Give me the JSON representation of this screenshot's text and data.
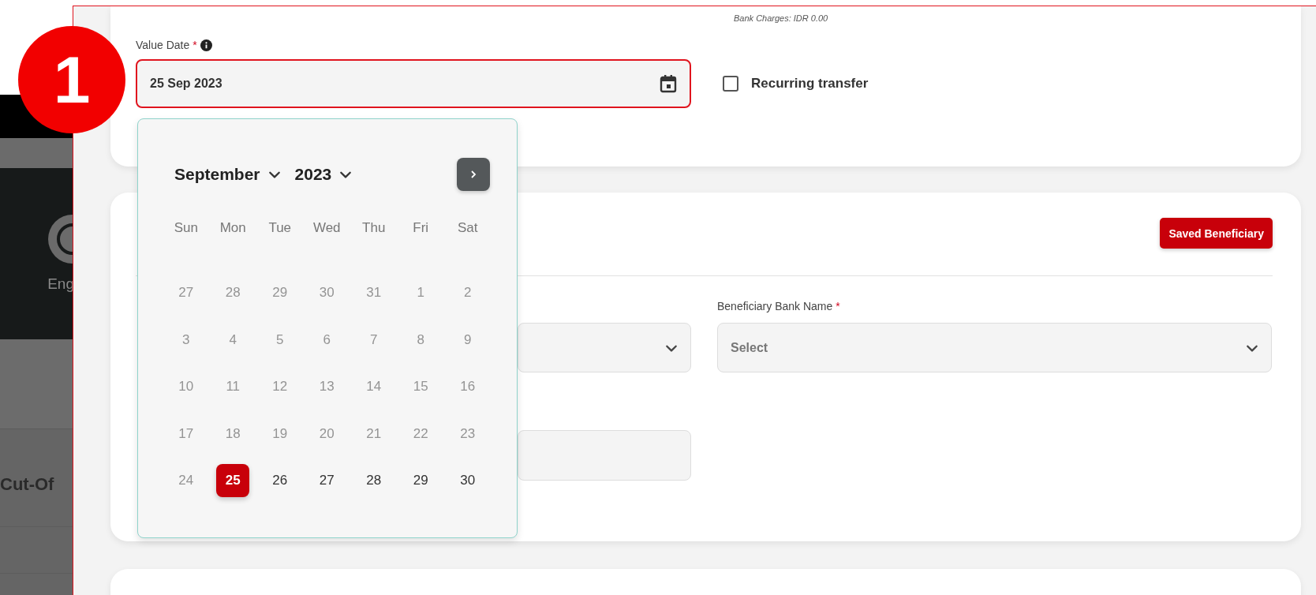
{
  "step_badge": "1",
  "background_panel": {
    "language_label": "Eng",
    "cutoff_label": "Cut-Of"
  },
  "bank_charges": "Bank Charges: IDR 0.00",
  "value_date": {
    "label": "Value Date",
    "required_mark": "*",
    "value": "25 Sep 2023",
    "focused": true
  },
  "recurring_transfer": {
    "label": "Recurring transfer",
    "checked": false
  },
  "calendar": {
    "month": "September",
    "year": "2023",
    "weekdays": [
      "Sun",
      "Mon",
      "Tue",
      "Wed",
      "Thu",
      "Fri",
      "Sat"
    ],
    "days": [
      {
        "label": "27",
        "disabled": true,
        "selected": false
      },
      {
        "label": "28",
        "disabled": true,
        "selected": false
      },
      {
        "label": "29",
        "disabled": true,
        "selected": false
      },
      {
        "label": "30",
        "disabled": true,
        "selected": false
      },
      {
        "label": "31",
        "disabled": true,
        "selected": false
      },
      {
        "label": "1",
        "disabled": true,
        "selected": false
      },
      {
        "label": "2",
        "disabled": true,
        "selected": false
      },
      {
        "label": "3",
        "disabled": true,
        "selected": false
      },
      {
        "label": "4",
        "disabled": true,
        "selected": false
      },
      {
        "label": "5",
        "disabled": true,
        "selected": false
      },
      {
        "label": "6",
        "disabled": true,
        "selected": false
      },
      {
        "label": "7",
        "disabled": true,
        "selected": false
      },
      {
        "label": "8",
        "disabled": true,
        "selected": false
      },
      {
        "label": "9",
        "disabled": true,
        "selected": false
      },
      {
        "label": "10",
        "disabled": true,
        "selected": false
      },
      {
        "label": "11",
        "disabled": true,
        "selected": false
      },
      {
        "label": "12",
        "disabled": true,
        "selected": false
      },
      {
        "label": "13",
        "disabled": true,
        "selected": false
      },
      {
        "label": "14",
        "disabled": true,
        "selected": false
      },
      {
        "label": "15",
        "disabled": true,
        "selected": false
      },
      {
        "label": "16",
        "disabled": true,
        "selected": false
      },
      {
        "label": "17",
        "disabled": true,
        "selected": false
      },
      {
        "label": "18",
        "disabled": true,
        "selected": false
      },
      {
        "label": "19",
        "disabled": true,
        "selected": false
      },
      {
        "label": "20",
        "disabled": true,
        "selected": false
      },
      {
        "label": "21",
        "disabled": true,
        "selected": false
      },
      {
        "label": "22",
        "disabled": true,
        "selected": false
      },
      {
        "label": "23",
        "disabled": true,
        "selected": false
      },
      {
        "label": "24",
        "disabled": true,
        "selected": false
      },
      {
        "label": "25",
        "disabled": false,
        "selected": true
      },
      {
        "label": "26",
        "disabled": false,
        "selected": false
      },
      {
        "label": "27",
        "disabled": false,
        "selected": false
      },
      {
        "label": "28",
        "disabled": false,
        "selected": false
      },
      {
        "label": "29",
        "disabled": false,
        "selected": false
      },
      {
        "label": "30",
        "disabled": false,
        "selected": false
      }
    ]
  },
  "beneficiary": {
    "saved_button": "Saved Beneficiary",
    "bank_name": {
      "label": "Beneficiary Bank Name",
      "required_mark": "*",
      "placeholder": "Select"
    }
  }
}
